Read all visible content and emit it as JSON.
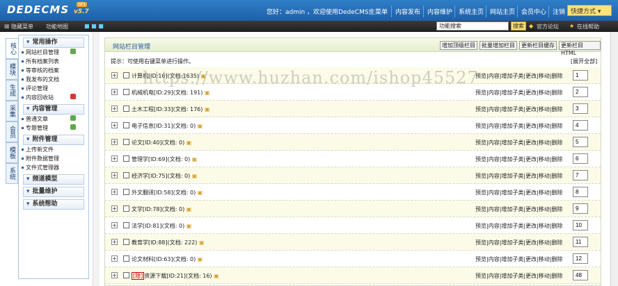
{
  "app": {
    "logo": "DEDECMS",
    "version": "v5.7",
    "badge": "SP1"
  },
  "header": {
    "greeting": "您好：admin ，欢迎使用DedeCMS!",
    "nav": [
      "主菜单",
      "内容发布",
      "内容维护",
      "系统主页",
      "网站主页",
      "会员中心",
      "注销"
    ],
    "quick": "快捷方式 ▾"
  },
  "subbar": {
    "hide_menu": "隐藏菜单",
    "func_map": "功能地图",
    "search_value": "功能搜索",
    "search_btn": "搜索",
    "forum": "官方论坛",
    "help": "在线帮助"
  },
  "tabs": [
    "核心",
    "模块",
    "生成",
    "采集",
    "会员",
    "模板",
    "系统"
  ],
  "sidebar": {
    "groups": [
      {
        "title": "常用操作",
        "items": [
          "网站栏目管理",
          "所有档案列表",
          "等审核的档案",
          "我发布的文档",
          "评论管理",
          "内容回收站"
        ]
      },
      {
        "title": "内容管理",
        "items": [
          "普通文章",
          "专题管理"
        ]
      },
      {
        "title": "附件管理",
        "items": [
          "上传新文件",
          "附件数据管理",
          "文件式管理器"
        ]
      },
      {
        "title": "频道模型",
        "items": []
      },
      {
        "title": "批量维护",
        "items": []
      },
      {
        "title": "系统帮助",
        "items": []
      }
    ]
  },
  "main": {
    "title": "网站栏目管理",
    "buttons": [
      "增加顶级栏目",
      "批量增加栏目",
      "更新栏目缓存",
      "更新栏目HTML"
    ],
    "tip": "提示：可使用右键菜单进行操作。",
    "expand_all": "[展开全部]",
    "ops": "预览|内容|增加子类|更改|移动|删除",
    "rows": [
      {
        "name": "计算机[ID:16](文档:1635)",
        "order": "1"
      },
      {
        "name": "机械机电[ID:29](文档: 191)",
        "order": "2"
      },
      {
        "name": "土木工程[ID:33](文档: 176)",
        "order": "3"
      },
      {
        "name": "电子信息[ID:31](文档: 0)",
        "order": "4"
      },
      {
        "name": "论文[ID:40](文档: 0)",
        "order": "5"
      },
      {
        "name": "管理学[ID:69](文档: 0)",
        "order": "6"
      },
      {
        "name": "经济学[ID:75](文档: 0)",
        "order": "7"
      },
      {
        "name": "外文翻译[ID:58](文档: 0)",
        "order": "8"
      },
      {
        "name": "文学[ID:78](文档: 0)",
        "order": "9"
      },
      {
        "name": "法学[ID:81](文档: 0)",
        "order": "10"
      },
      {
        "name": "教育学[ID:88](文档: 222)",
        "order": "11"
      },
      {
        "name": "论文材料[ID:63](文档: 0)",
        "order": "12"
      },
      {
        "name": "资源下载[ID:21](文档: 16)",
        "order": "48",
        "tag": "[隐]"
      }
    ]
  },
  "watermark": "https://www.huzhan.com/ishop45527"
}
